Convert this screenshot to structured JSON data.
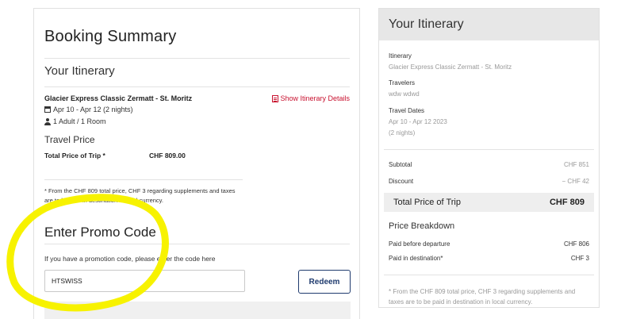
{
  "booking": {
    "title": "Booking Summary",
    "itinerary_heading": "Your Itinerary",
    "trip_name": "Glacier Express Classic Zermatt - St. Moritz",
    "show_details": "Show Itinerary Details",
    "dates": "Apr 10 - Apr 12 (2 nights)",
    "guests": "1 Adult / 1 Room",
    "travel_price_heading": "Travel Price",
    "total_label": "Total Price of Trip *",
    "total_value": "CHF 809.00",
    "footnote": "* From the CHF 809 total price, CHF 3 regarding supplements and taxes are to be paid in destination in local currency."
  },
  "promo": {
    "heading": "Enter Promo Code",
    "hint": "If you have a promotion code, please enter the code here",
    "value": "HTSWISS",
    "redeem_label": "Redeem"
  },
  "summary": {
    "title": "Your Itinerary",
    "itinerary_label": "Itinerary",
    "itinerary_value": "Glacier Express Classic Zermatt - St. Moritz",
    "travelers_label": "Travelers",
    "travelers_value": "wdw wdwd",
    "dates_label": "Travel Dates",
    "dates_value": "Apr 10 - Apr 12 2023",
    "nights_value": "(2 nights)",
    "subtotal_label": "Subtotal",
    "subtotal_value": "CHF 851",
    "discount_label": "Discount",
    "discount_value": "− CHF 42",
    "total_label": "Total Price of Trip",
    "total_value": "CHF 809",
    "breakdown_heading": "Price Breakdown",
    "paid_before_label": "Paid before departure",
    "paid_before_value": "CHF 806",
    "paid_dest_label": "Paid in destination*",
    "paid_dest_value": "CHF 3",
    "footnote": "* From the CHF 809 total price, CHF 3 regarding supplements and taxes are to be paid in destination in local currency."
  },
  "colors": {
    "link": "#c8102e",
    "button": "#1f3b6e",
    "highlight": "#f7f200"
  },
  "icons": [
    "itinerary-details-icon",
    "calendar-icon",
    "person-icon"
  ]
}
